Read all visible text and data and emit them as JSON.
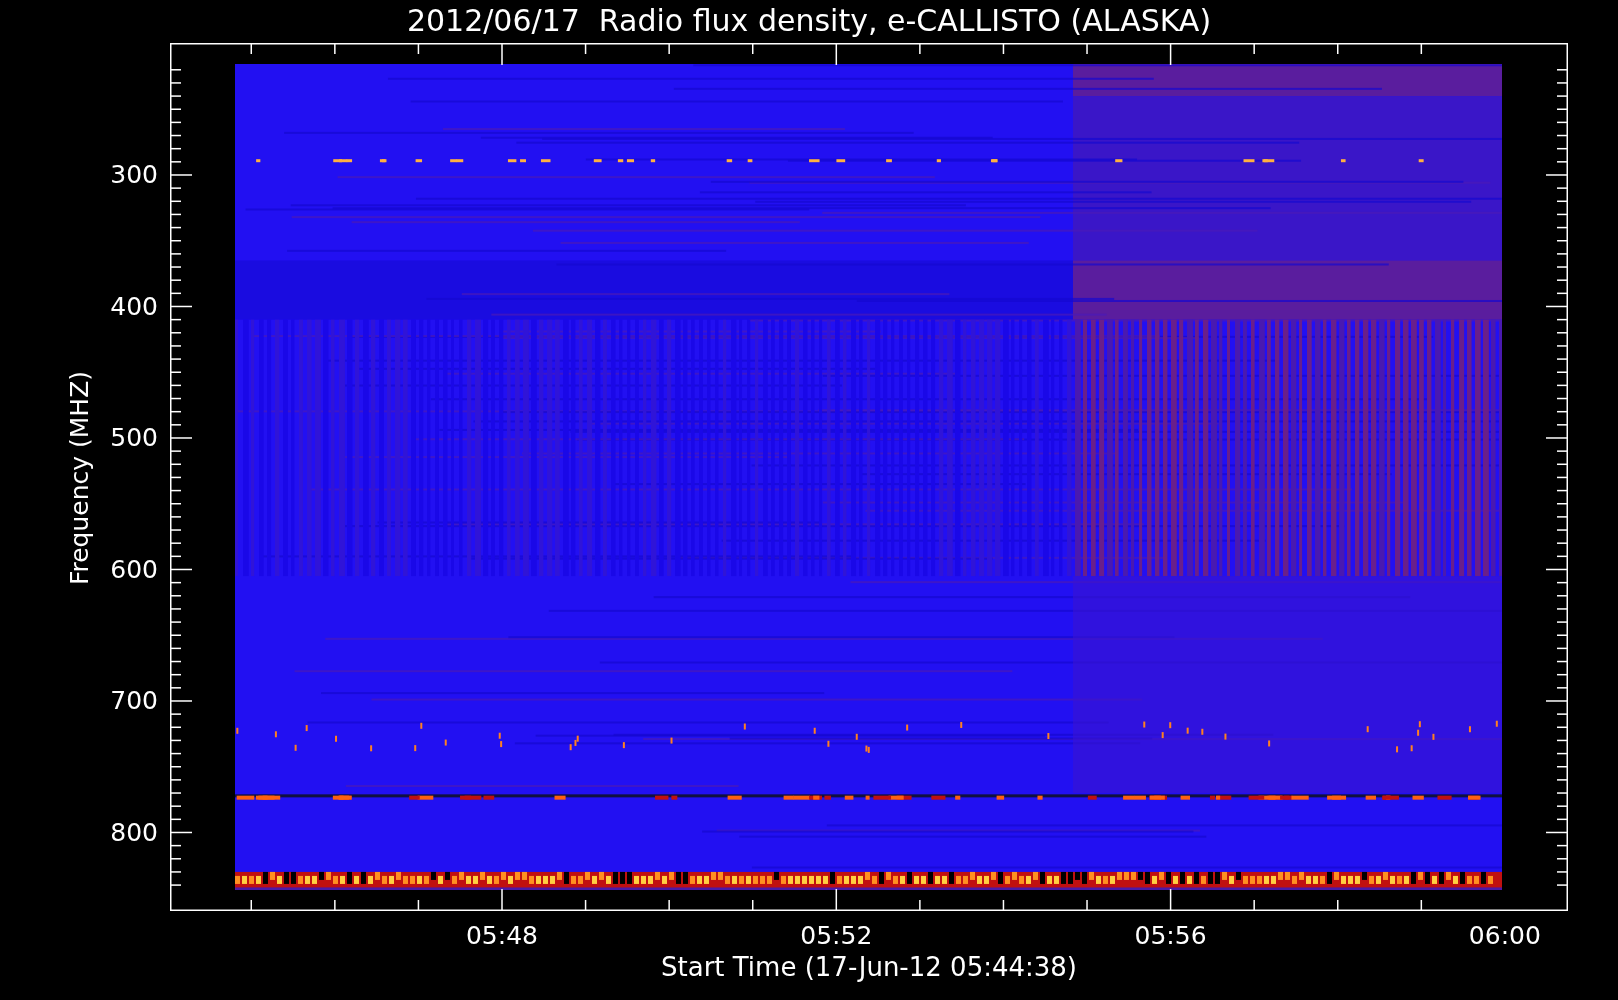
{
  "title": "2012/06/17  Radio flux density, e-CALLISTO (ALASKA)",
  "y_axis": {
    "label": "Frequency (MHZ)",
    "ticks": [
      "300",
      "400",
      "500",
      "600",
      "700",
      "800"
    ]
  },
  "x_axis": {
    "label": "Start Time (17-Jun-12 05:44:38)",
    "ticks": [
      "05:48",
      "05:52",
      "05:56",
      "06:00"
    ]
  }
}
